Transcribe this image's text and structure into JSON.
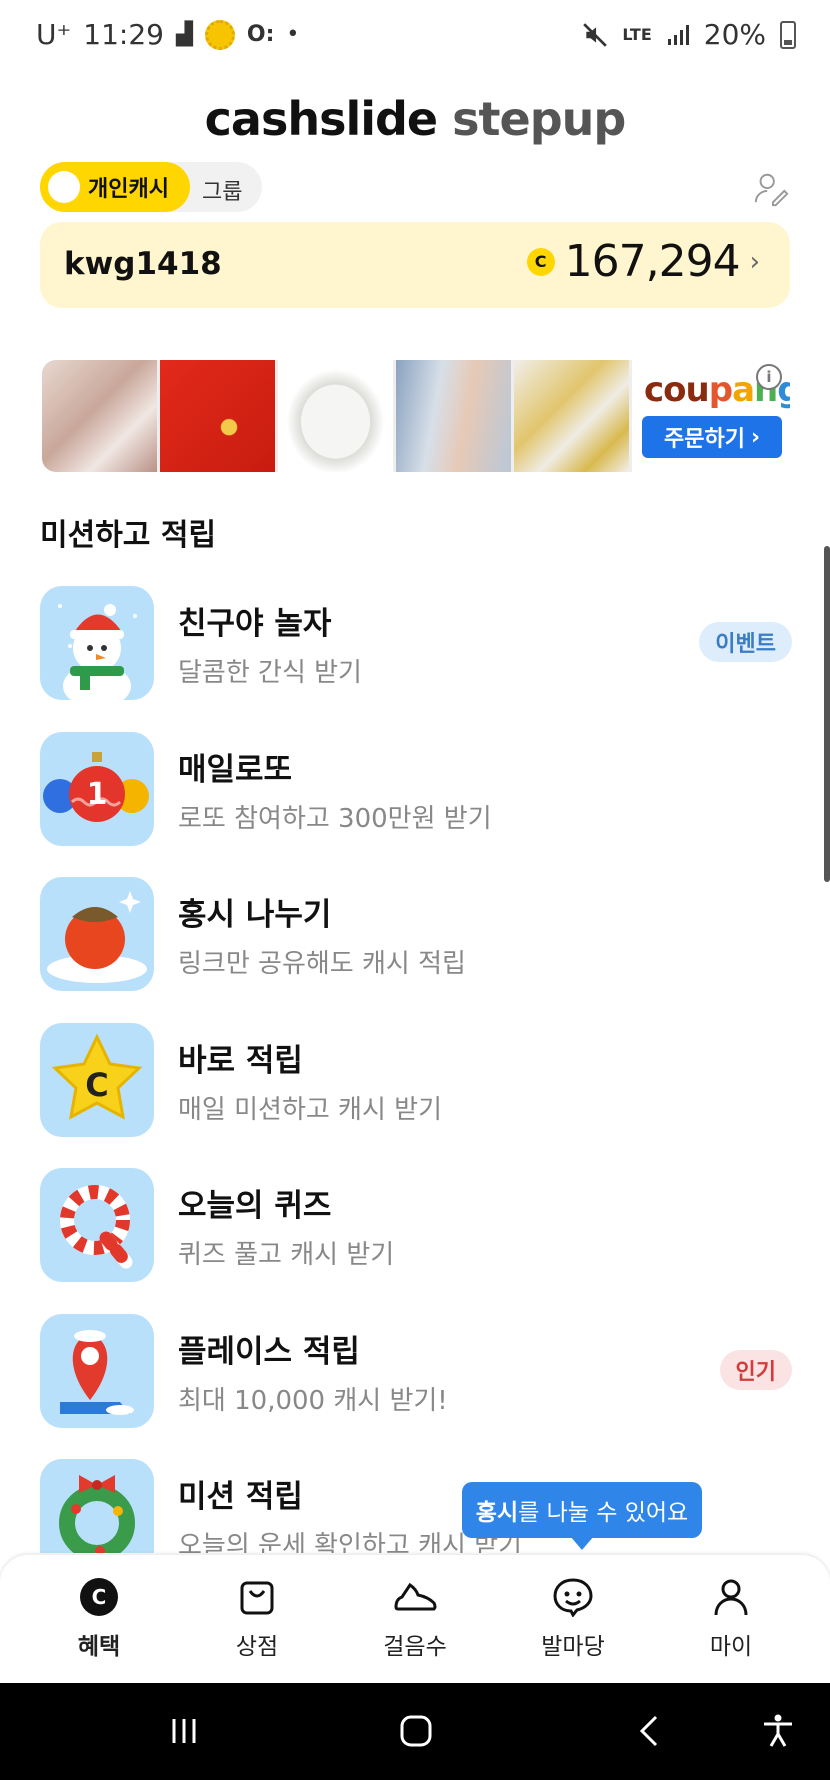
{
  "status_bar": {
    "carrier": "U⁺",
    "time": "11:29",
    "network": "LTE",
    "battery": "20%"
  },
  "logo": {
    "part1": "cashslide",
    "part2": "stepup"
  },
  "toggle": {
    "active_label": "개인캐시",
    "inactive_label": "그룹"
  },
  "cash": {
    "username": "kwg1418",
    "coin_symbol": "C",
    "amount": "167,294"
  },
  "ad": {
    "brand": [
      "cou",
      "p",
      "a",
      "n",
      "g"
    ],
    "order_button": "주문하기",
    "info_symbol": "i"
  },
  "section_title": "미션하고 적립",
  "missions": [
    {
      "title": "친구야 놀자",
      "subtitle": "달콤한 간식 받기",
      "badge": "이벤트",
      "badge_type": "event",
      "icon": "snowman-icon"
    },
    {
      "title": "매일로또",
      "subtitle": "로또 참여하고 300만원 받기",
      "icon": "lotto-balls-icon"
    },
    {
      "title": "홍시 나누기",
      "subtitle": "링크만 공유해도 캐시 적립",
      "icon": "persimmon-icon"
    },
    {
      "title": "바로 적립",
      "subtitle": "매일 미션하고 캐시 받기",
      "icon": "star-coin-icon"
    },
    {
      "title": "오늘의 퀴즈",
      "subtitle": "퀴즈 풀고 캐시 받기",
      "icon": "candy-cane-q-icon"
    },
    {
      "title": "플레이스 적립",
      "subtitle": "최대 10,000 캐시 받기!",
      "badge": "인기",
      "badge_type": "popular",
      "icon": "map-pin-icon"
    },
    {
      "title": "미션 적립",
      "subtitle": "오늘의 운세 확인하고 캐시 받기",
      "icon": "wreath-icon"
    }
  ],
  "tooltip": {
    "bold": "홍시",
    "rest": "를 나눌 수 있어요"
  },
  "bottom_nav": [
    {
      "label": "혜택",
      "icon": "coin-c-icon",
      "active": true
    },
    {
      "label": "상점",
      "icon": "shopping-bag-icon",
      "active": false
    },
    {
      "label": "걸음수",
      "icon": "sneaker-icon",
      "active": false
    },
    {
      "label": "발마당",
      "icon": "smile-chat-icon",
      "active": false
    },
    {
      "label": "마이",
      "icon": "person-icon",
      "active": false
    }
  ],
  "colors": {
    "accent_yellow": "#ffd600",
    "card_bg": "#fff6cf",
    "mission_icon_bg": "#b9e0fb",
    "tooltip_blue": "#2f86e8"
  }
}
